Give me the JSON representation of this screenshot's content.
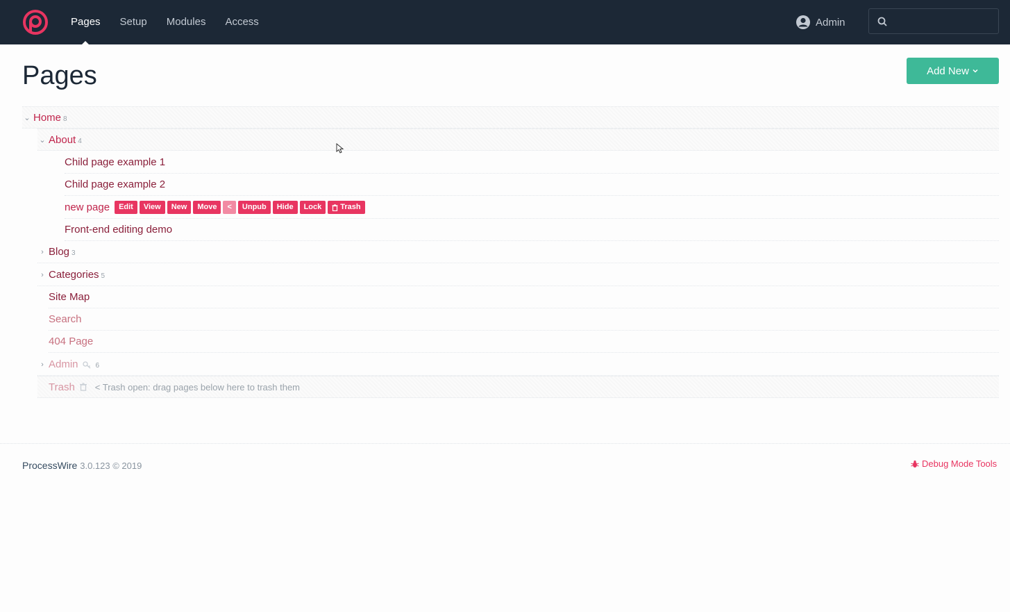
{
  "nav": {
    "items": [
      {
        "label": "Pages",
        "active": true
      },
      {
        "label": "Setup",
        "active": false
      },
      {
        "label": "Modules",
        "active": false
      },
      {
        "label": "Access",
        "active": false
      }
    ],
    "user": "Admin",
    "search_placeholder": ""
  },
  "page": {
    "title": "Pages",
    "add_new_label": "Add New"
  },
  "tree": {
    "home": {
      "label": "Home",
      "count": "8"
    },
    "about": {
      "label": "About",
      "count": "4"
    },
    "child1": {
      "label": "Child page example 1"
    },
    "child2": {
      "label": "Child page example 2"
    },
    "newpage": {
      "label": "new page"
    },
    "actions": {
      "edit": "Edit",
      "view": "View",
      "new": "New",
      "move": "Move",
      "back": "<",
      "unpub": "Unpub",
      "hide": "Hide",
      "lock": "Lock",
      "trash": "Trash"
    },
    "frontend": {
      "label": "Front-end editing demo"
    },
    "blog": {
      "label": "Blog",
      "count": "3"
    },
    "categories": {
      "label": "Categories",
      "count": "5"
    },
    "sitemap": {
      "label": "Site Map"
    },
    "search": {
      "label": "Search"
    },
    "notfound": {
      "label": "404 Page"
    },
    "admin": {
      "label": "Admin",
      "count": "6"
    },
    "trash": {
      "label": "Trash",
      "note": "< Trash open: drag pages below here to trash them"
    }
  },
  "footer": {
    "brand": "ProcessWire",
    "version": "3.0.123 © 2019",
    "debug_label": "Debug Mode Tools"
  },
  "colors": {
    "topbar": "#1c2836",
    "accent": "#e83561",
    "button": "#3eb998"
  }
}
